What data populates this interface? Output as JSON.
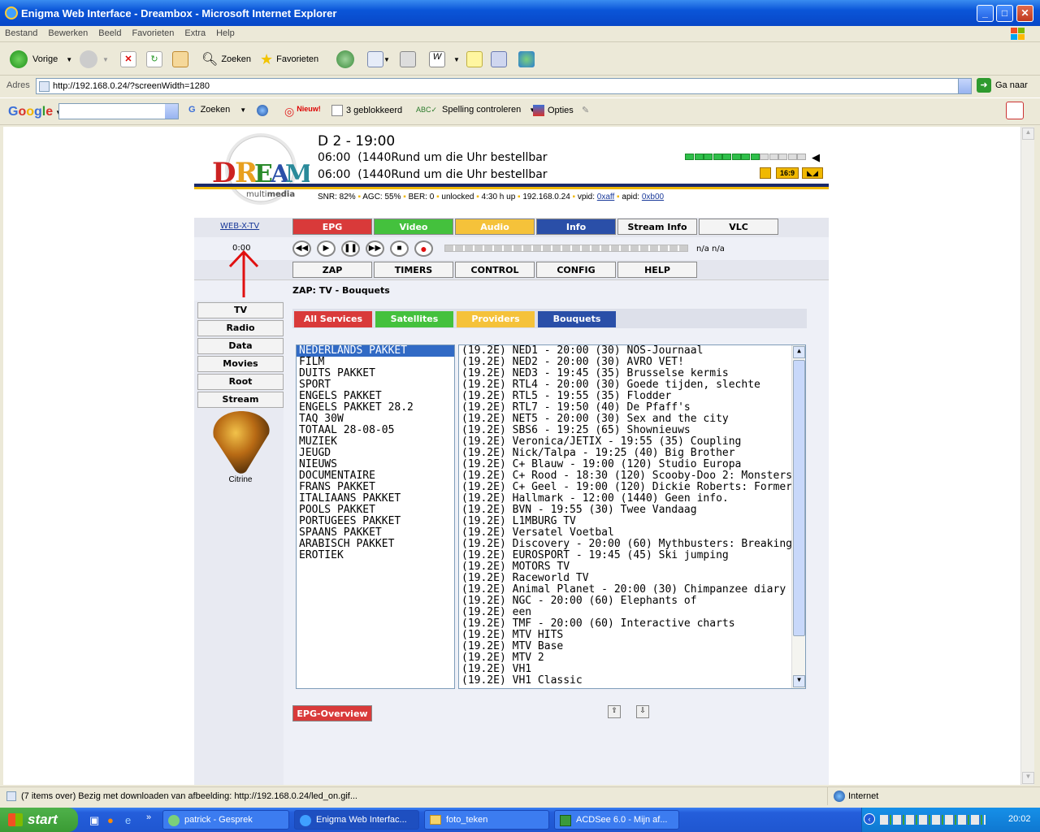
{
  "window": {
    "title": "Enigma Web Interface - Dreambox - Microsoft Internet Explorer"
  },
  "menu": [
    "Bestand",
    "Bewerken",
    "Beeld",
    "Favorieten",
    "Extra",
    "Help"
  ],
  "toolbar": {
    "back": "Vorige",
    "search": "Zoeken",
    "favorites": "Favorieten"
  },
  "address": {
    "label": "Adres",
    "url": "http://192.168.0.24/?screenWidth=1280",
    "go": "Ga naar"
  },
  "google": {
    "search_button": "Zoeken",
    "new_label": "Nieuw!",
    "blocked": "3 geblokkeerd",
    "spelling": "Spelling controleren",
    "options": "Opties"
  },
  "header": {
    "channel": "D 2 - 19:00",
    "events": [
      {
        "time": "06:00",
        "duration": "(1440",
        "title": "Rund um die Uhr bestellbar"
      },
      {
        "time": "06:00",
        "duration": "(1440",
        "title": "Rund um die Uhr bestellbar"
      }
    ],
    "volume_level": 0.6,
    "aspect": "16:9",
    "status": {
      "snr": "SNR: 82%",
      "agc": "AGC: 55%",
      "ber": "BER: 0",
      "lock": "unlocked",
      "uptime": "4:30 h up",
      "ip": "192.168.0.24",
      "vpid_label": "vpid:",
      "vpid": "0xaff",
      "apid_label": "apid:",
      "apid": "0xb00"
    }
  },
  "nav": {
    "webxtv": "WEB-X-TV",
    "top_buttons": [
      "EPG",
      "Video",
      "Audio",
      "Info",
      "Stream Info",
      "VLC"
    ],
    "time": "0:00",
    "progress_text": "n/a n/a",
    "sub_buttons": [
      "ZAP",
      "TIMERS",
      "CONTROL",
      "CONFIG",
      "HELP"
    ],
    "breadcrumb": "ZAP: TV - Bouquets"
  },
  "sidebar": {
    "items": [
      "TV",
      "Radio",
      "Data",
      "Movies",
      "Root",
      "Stream"
    ],
    "image_caption": "Citrine"
  },
  "tabs": [
    "All Services",
    "Satellites",
    "Providers",
    "Bouquets"
  ],
  "bouquets": [
    "NEDERLANDS PAKKET",
    "FILM",
    "DUITS  PAKKET",
    "SPORT",
    "ENGELS  PAKKET",
    "ENGELS PAKKET 28.2",
    "TAQ 30W",
    "TOTAAL 28-08-05",
    "MUZIEK",
    "JEUGD",
    "NIEUWS",
    "DOCUMENTAIRE",
    "FRANS PAKKET",
    "ITALIAANS PAKKET",
    "POOLS PAKKET",
    "PORTUGEES PAKKET",
    "SPAANS PAKKET",
    "ARABISCH PAKKET",
    "EROTIEK"
  ],
  "services": [
    "(19.2E) NED1 - 20:00 (30) NOS-Journaal",
    "(19.2E) NED2 - 20:00 (30) AVRO VET!",
    "(19.2E) NED3 - 19:45 (35) Brusselse kermis",
    "(19.2E) RTL4 - 20:00 (30) Goede tijden, slechte",
    "(19.2E) RTL5 - 19:55 (35) Flodder",
    "(19.2E) RTL7 - 19:50 (40) De Pfaff's",
    "(19.2E) NET5 - 20:00 (30) Sex and the city",
    "(19.2E) SBS6 - 19:25 (65) Shownieuws",
    "(19.2E) Veronica/JETIX - 19:55 (35) Coupling",
    "(19.2E) Nick/Talpa - 19:25 (40) Big Brother",
    "(19.2E) C+ Blauw - 19:00 (120) Studio Europa",
    "(19.2E) C+ Rood - 18:30 (120) Scooby-Doo 2: Monsters",
    "(19.2E) C+ Geel - 19:00 (120) Dickie Roberts: Former",
    "(19.2E) Hallmark - 12:00 (1440) Geen info.",
    "(19.2E) BVN - 19:55 (30) Twee Vandaag",
    "(19.2E) L1MBURG TV",
    "(19.2E) Versatel Voetbal",
    "(19.2E) Discovery - 20:00 (60) Mythbusters: Breaking",
    "(19.2E) EUROSPORT - 19:45 (45) Ski jumping",
    "(19.2E) MOTORS TV",
    "(19.2E) Raceworld TV",
    "(19.2E) Animal Planet - 20:00 (30) Chimpanzee diary",
    "(19.2E) NGC - 20:00 (60) Elephants of",
    "(19.2E) een",
    "(19.2E) TMF - 20:00 (60) Interactive charts",
    "(19.2E) MTV HITS",
    "(19.2E) MTV Base",
    "(19.2E) MTV 2",
    "(19.2E) VH1",
    "(19.2E) VH1 Classic"
  ],
  "epg_overview": "EPG-Overview",
  "statusbar": {
    "text": "(7 items over) Bezig met downloaden van afbeelding: http://192.168.0.24/led_on.gif...",
    "zone": "Internet"
  },
  "taskbar": {
    "start": "start",
    "tasks": [
      "patrick - Gesprek",
      "Enigma Web Interfac...",
      "foto_teken",
      "ACDSee 6.0 - Mijn af..."
    ],
    "clock": "20:02"
  },
  "colors": {
    "epg": "#d93a3a",
    "video": "#44c13d",
    "audio": "#f5c23a",
    "info": "#2a4fa8",
    "accent_navy": "#1a2a6a"
  }
}
